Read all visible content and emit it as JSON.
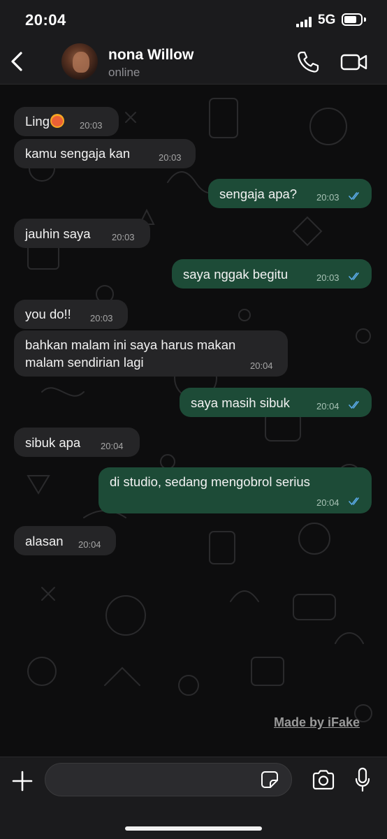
{
  "status_bar": {
    "time": "20:04",
    "network": "5G",
    "battery_level": 0.75
  },
  "header": {
    "contact_name": "nona Willow",
    "contact_status": "online"
  },
  "messages": [
    {
      "side": "in",
      "text": "Ling",
      "emoji": "angry-face",
      "time": "20:03"
    },
    {
      "side": "in",
      "text": "kamu sengaja kan",
      "time": "20:03"
    },
    {
      "side": "out",
      "text": "sengaja apa?",
      "time": "20:03",
      "status": "read"
    },
    {
      "side": "in",
      "text": "jauhin saya",
      "time": "20:03"
    },
    {
      "side": "out",
      "text": "saya nggak begitu",
      "time": "20:03",
      "status": "read"
    },
    {
      "side": "in",
      "text": "you do!!",
      "time": "20:03"
    },
    {
      "side": "in",
      "text_lines": [
        "bahkan malam ini saya harus makan",
        "malam sendirian lagi"
      ],
      "time": "20:04"
    },
    {
      "side": "out",
      "text": "saya masih sibuk",
      "time": "20:04",
      "status": "read"
    },
    {
      "side": "in",
      "text": "sibuk apa",
      "time": "20:04"
    },
    {
      "side": "out",
      "text": "di studio, sedang mengobrol serius",
      "time": "20:04",
      "status": "read"
    },
    {
      "side": "in",
      "text": "alasan",
      "time": "20:04"
    }
  ],
  "watermark": "Made by iFake",
  "input": {
    "placeholder": "",
    "value": ""
  },
  "colors": {
    "incoming_bubble": "#252527",
    "outgoing_bubble": "#1d4b37",
    "read_ticks": "#5aa9e6",
    "background": "#0d0d0e"
  }
}
